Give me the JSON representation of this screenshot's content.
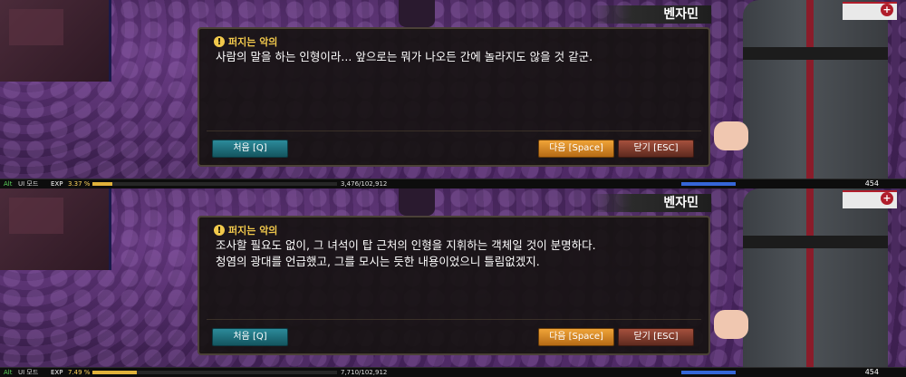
{
  "panels": [
    {
      "speaker": "벤자민",
      "quest_title": "퍼지는 악의",
      "dialogue": "사람의 말을 하는 인형이라... 앞으로는 뭐가 나오든 간에 놀라지도 않을 것 같군.",
      "buttons": {
        "first": "처음 [Q]",
        "next": "다음 [Space]",
        "close": "닫기 [ESC]"
      },
      "hud": {
        "alt": "Alt",
        "mode": "UI 모드",
        "exp_label": "EXP",
        "exp_percent": "3.37 %",
        "exp_value": "3,476/102,912",
        "hp": "454"
      },
      "exp_fraction": 0.0337
    },
    {
      "speaker": "벤자민",
      "quest_title": "퍼지는 악의",
      "dialogue": "조사할 필요도 없이, 그 녀석이 탑 근처의 인형을 지휘하는 객체일 것이 분명하다.\n청염의 광대를 언급했고, 그를 모시는 듯한 내용이었으니 틀림없겠지.",
      "buttons": {
        "first": "처음 [Q]",
        "next": "다음 [Space]",
        "close": "닫기 [ESC]"
      },
      "hud": {
        "alt": "Alt",
        "mode": "UI 모드",
        "exp_label": "EXP",
        "exp_percent": "7.49 %",
        "exp_value": "7,710/102,912",
        "hp": "454"
      },
      "exp_fraction": 0.0749
    }
  ],
  "colors": {
    "title": "#f2c94c",
    "first_btn": "#2c8a9a",
    "next_btn": "#f0a438",
    "close_btn": "#a5503d"
  },
  "icons": {
    "quest": "warning-icon",
    "armband": "cross-icon"
  }
}
